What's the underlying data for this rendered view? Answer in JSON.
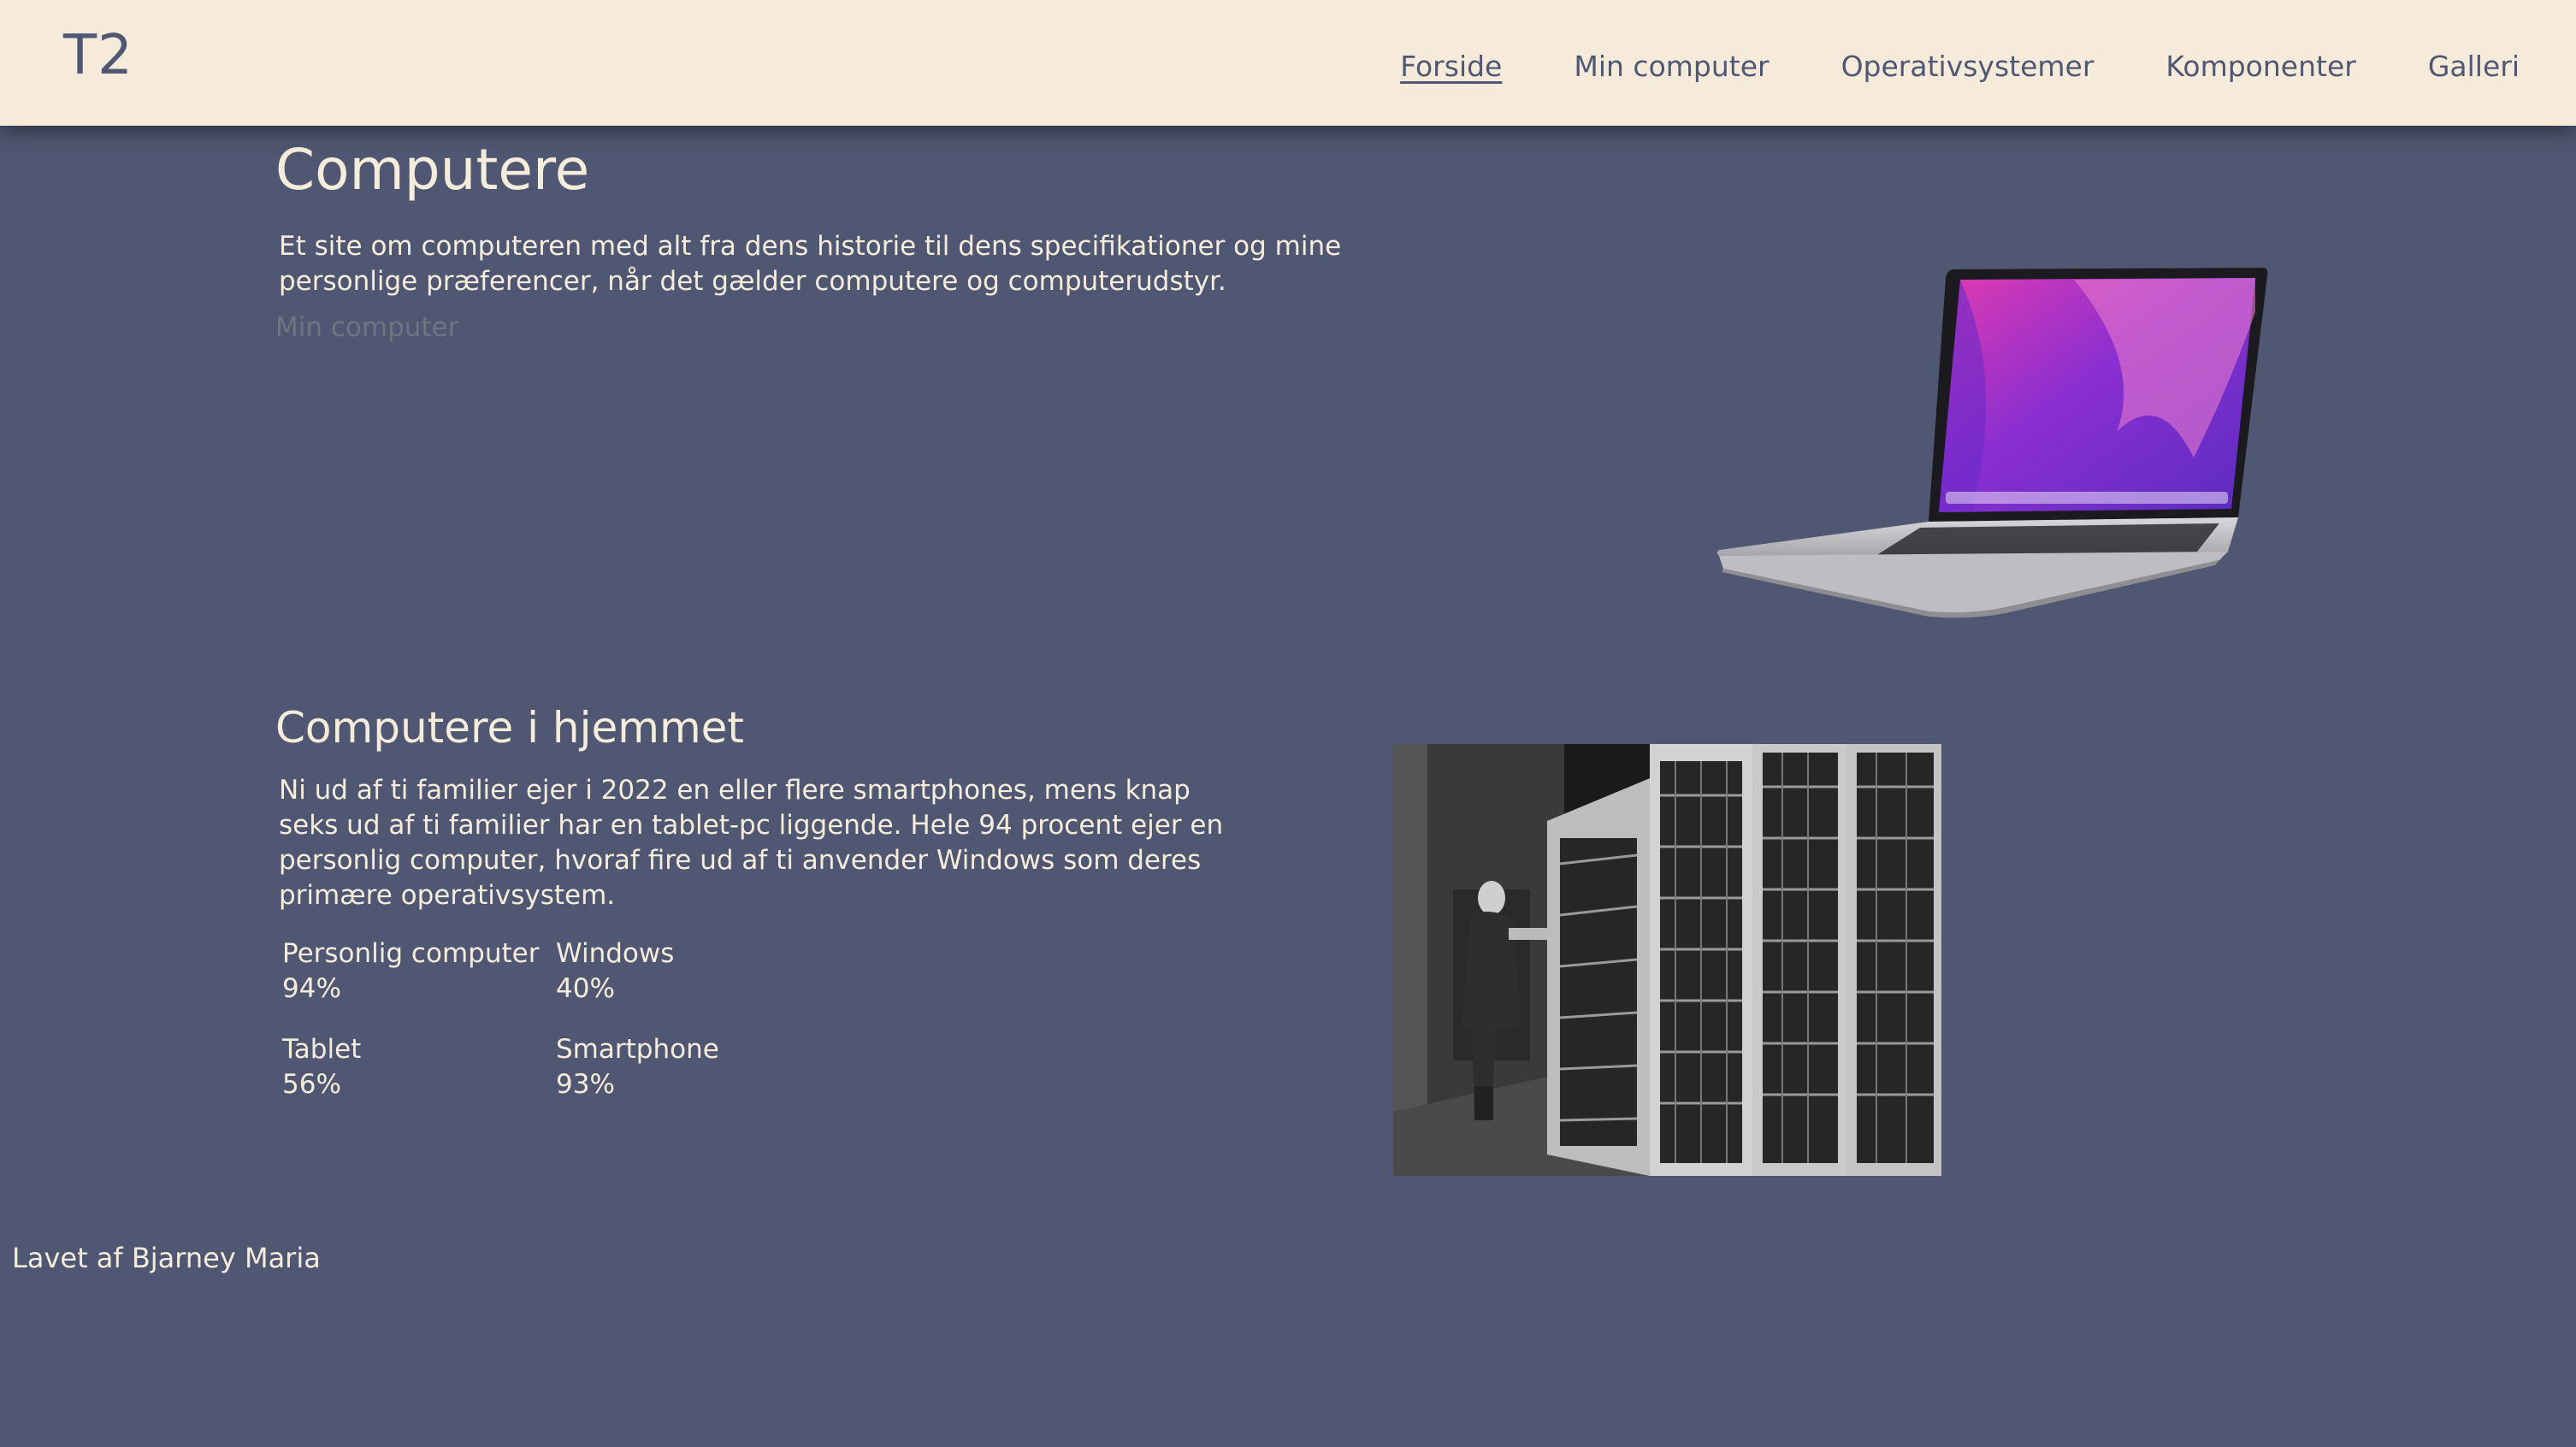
{
  "header": {
    "logo": "T2",
    "nav": [
      {
        "label": "Forside",
        "active": true
      },
      {
        "label": "Min computer",
        "active": false
      },
      {
        "label": "Operativsystemer",
        "active": false
      },
      {
        "label": "Komponenter",
        "active": false
      },
      {
        "label": "Galleri",
        "active": false
      }
    ]
  },
  "hero": {
    "title": "Computere",
    "text": "Et site om computeren med alt fra dens historie til dens specifikationer og mine personlige præferencer, når det gælder computere og computerudstyr.",
    "link": "Min computer"
  },
  "home": {
    "title": "Computere i hjemmet",
    "text": "Ni ud af ti familier ejer i 2022 en eller flere smartphones, mens knap seks ud af ti familier har en tablet-pc liggende. Hele 94 procent ejer en personlig computer, hvoraf fire ud af ti anvender Windows som deres primære operativsystem.",
    "stats": [
      {
        "label": "Personlig computer",
        "value": "94%"
      },
      {
        "label": "Windows",
        "value": "40%"
      },
      {
        "label": "Tablet",
        "value": "56%"
      },
      {
        "label": "Smartphone",
        "value": "93%"
      }
    ]
  },
  "footer": {
    "text": "Lavet af Bjarney Maria"
  },
  "colors": {
    "background": "#4f5772",
    "header": "#f6ebda",
    "text": "#f5ecdc"
  }
}
